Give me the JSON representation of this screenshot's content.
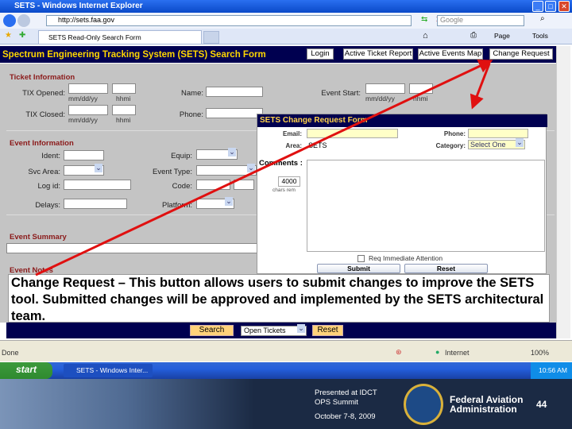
{
  "browser": {
    "title": "SETS - Windows Internet Explorer",
    "url": "http://sets.faa.gov",
    "search_placeholder": "Google",
    "tab": "SETS Read-Only Search Form",
    "page_menu": "Page",
    "tools_menu": "Tools"
  },
  "header": {
    "title": "Spectrum Engineering Tracking System (SETS) Search Form",
    "buttons": [
      "Login",
      "Active Ticket Report",
      "Active Events Map",
      "Change Request"
    ]
  },
  "ticket": {
    "section": "Ticket Information",
    "tix_opened": "TIX Opened:",
    "tix_closed": "TIX Closed:",
    "date_hint": "mm/dd/yy",
    "time_hint": "hhmi",
    "name": "Name:",
    "phone": "Phone:",
    "event_start": "Event Start:"
  },
  "event": {
    "section": "Event Information",
    "ident": "Ident:",
    "svc_area": "Svc Area:",
    "log_id": "Log id:",
    "delays": "Delays:",
    "equip": "Equip:",
    "event_type": "Event Type:",
    "code": "Code:",
    "platform": "Platform:"
  },
  "summary": {
    "section": "Event Summary"
  },
  "notes": {
    "section": "Event Notes"
  },
  "popup": {
    "title": "SETS Change Request Form",
    "email": "Email:",
    "phone": "Phone:",
    "area": "Area:",
    "area_value": "SETS",
    "category": "Category:",
    "category_value": "Select One",
    "comments": "Comments :",
    "chars": "4000",
    "chars_label": "chars rem",
    "attention": "Req Immediate Attention",
    "submit": "Submit",
    "reset": "Reset"
  },
  "callout": "Change Request – This button allows users to submit changes to improve the SETS tool.  Submitted changes will be approved and implemented by the SETS architectural team.",
  "bottom": {
    "search": "Search",
    "filter": "Open Tickets",
    "reset": "Reset"
  },
  "status": {
    "left": "Done",
    "zone": "Internet",
    "zoom": "100%"
  },
  "taskbar": {
    "start": "start",
    "task": "SETS - Windows Inter...",
    "clock": "10:56 AM"
  },
  "footer": {
    "presented": "Presented at IDCT",
    "event": "OPS Summit",
    "date": "October 7-8, 2009",
    "org1": "Federal Aviation",
    "org2": "Administration",
    "page": "44"
  }
}
